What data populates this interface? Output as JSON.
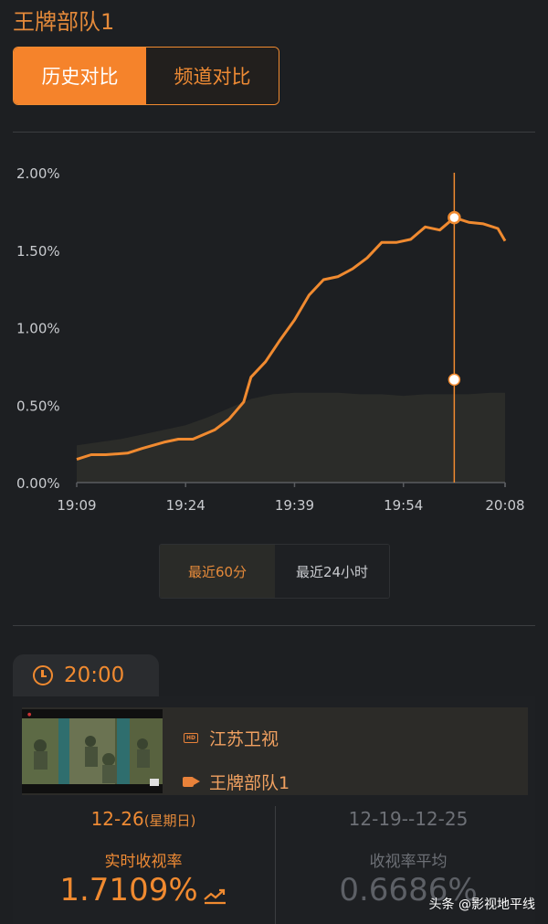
{
  "title": "王牌部队1",
  "tabs": {
    "history": "历史对比",
    "channel": "频道对比"
  },
  "chart_data": {
    "type": "area",
    "yticks": [
      "2.00%",
      "1.50%",
      "1.00%",
      "0.50%",
      "0.00%"
    ],
    "xticks": [
      "19:09",
      "19:24",
      "19:39",
      "19:54",
      "20:08"
    ],
    "ylim": [
      0,
      2.0
    ],
    "xlim": [
      "19:09",
      "20:08"
    ],
    "cursor_x": "20:01",
    "series": [
      {
        "color": "#f08a30",
        "style": "line",
        "points": [
          [
            "19:09",
            0.15
          ],
          [
            "19:11",
            0.18
          ],
          [
            "19:13",
            0.18
          ],
          [
            "19:16",
            0.19
          ],
          [
            "19:18",
            0.22
          ],
          [
            "19:21",
            0.26
          ],
          [
            "19:23",
            0.28
          ],
          [
            "19:25",
            0.28
          ],
          [
            "19:28",
            0.34
          ],
          [
            "19:30",
            0.41
          ],
          [
            "19:32",
            0.52
          ],
          [
            "19:33",
            0.68
          ],
          [
            "19:35",
            0.78
          ],
          [
            "19:37",
            0.92
          ],
          [
            "19:39",
            1.05
          ],
          [
            "19:41",
            1.21
          ],
          [
            "19:43",
            1.31
          ],
          [
            "19:45",
            1.33
          ],
          [
            "19:47",
            1.38
          ],
          [
            "19:49",
            1.45
          ],
          [
            "19:51",
            1.55
          ],
          [
            "19:53",
            1.55
          ],
          [
            "19:55",
            1.57
          ],
          [
            "19:57",
            1.65
          ],
          [
            "19:59",
            1.63
          ],
          [
            "20:01",
            1.71
          ],
          [
            "20:03",
            1.68
          ],
          [
            "20:05",
            1.67
          ],
          [
            "20:07",
            1.64
          ],
          [
            "20:08",
            1.56
          ]
        ]
      },
      {
        "color": "#2b2c29",
        "style": "area",
        "points": [
          [
            "19:09",
            0.24
          ],
          [
            "19:12",
            0.26
          ],
          [
            "19:15",
            0.28
          ],
          [
            "19:18",
            0.31
          ],
          [
            "19:21",
            0.34
          ],
          [
            "19:24",
            0.37
          ],
          [
            "19:27",
            0.42
          ],
          [
            "19:30",
            0.48
          ],
          [
            "19:33",
            0.54
          ],
          [
            "19:36",
            0.57
          ],
          [
            "19:39",
            0.58
          ],
          [
            "19:42",
            0.58
          ],
          [
            "19:45",
            0.58
          ],
          [
            "19:48",
            0.57
          ],
          [
            "19:51",
            0.57
          ],
          [
            "19:54",
            0.56
          ],
          [
            "19:57",
            0.57
          ],
          [
            "20:00",
            0.57
          ],
          [
            "20:03",
            0.57
          ],
          [
            "20:06",
            0.58
          ],
          [
            "20:08",
            0.58
          ]
        ]
      }
    ]
  },
  "range": {
    "active": "最近60分",
    "inactive": "最近24小时"
  },
  "schedule": {
    "time": "20:00",
    "channel": "江苏卫视",
    "program": "王牌部队1",
    "hd_badge": "HD"
  },
  "today": {
    "date": "12-26",
    "weekday": "(星期日)",
    "label": "实时收视率",
    "value": "1.7109%"
  },
  "week": {
    "date": "12-19--12-25",
    "label": "收视率平均",
    "value": "0.6686%"
  },
  "watermark": "头条 @影视地平线"
}
